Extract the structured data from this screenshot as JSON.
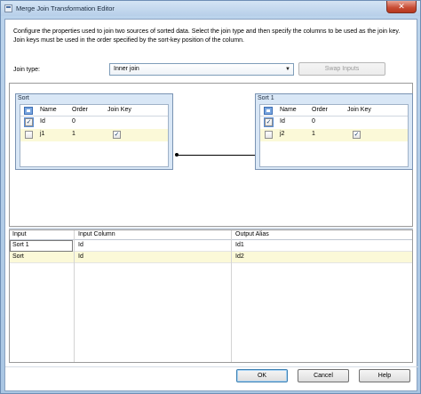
{
  "window": {
    "title": "Merge Join Transformation Editor",
    "close_glyph": "✕"
  },
  "description": "Configure the properties used to join two sources of sorted data. Select the join type and then specify the columns to be used as the join key. Join keys must be used in the order specified by the sort-key position of the column.",
  "join": {
    "label": "Join type:",
    "selected": "Inner join",
    "swap_label": "Swap Inputs"
  },
  "left_table": {
    "title": "Sort",
    "headers": [
      "Name",
      "Order",
      "Join Key"
    ],
    "rows": [
      {
        "select": true,
        "name": "Id",
        "order": "0",
        "join_key": false
      },
      {
        "select": false,
        "name": "j1",
        "order": "1",
        "join_key": true
      }
    ]
  },
  "right_table": {
    "title": "Sort 1",
    "headers": [
      "Name",
      "Order",
      "Join Key"
    ],
    "rows": [
      {
        "select": true,
        "name": "Id",
        "order": "0",
        "join_key": false
      },
      {
        "select": false,
        "name": "j2",
        "order": "1",
        "join_key": true
      }
    ]
  },
  "output": {
    "headers": [
      "Input",
      "Input Column",
      "Output Alias"
    ],
    "rows": [
      {
        "input": "Sort 1",
        "column": "Id",
        "alias": "Id1"
      },
      {
        "input": "Sort",
        "column": "Id",
        "alias": "Id2"
      }
    ]
  },
  "buttons": {
    "ok": "OK",
    "cancel": "Cancel",
    "help": "Help"
  },
  "icons": {
    "combo_arrow": "▼",
    "check_mark": "✓"
  },
  "colors": {
    "title_bar": "#b7cfe9",
    "close_button": "#c74a32",
    "alt_row": "#fbf9d8",
    "table_box": "#d9e7f6"
  }
}
